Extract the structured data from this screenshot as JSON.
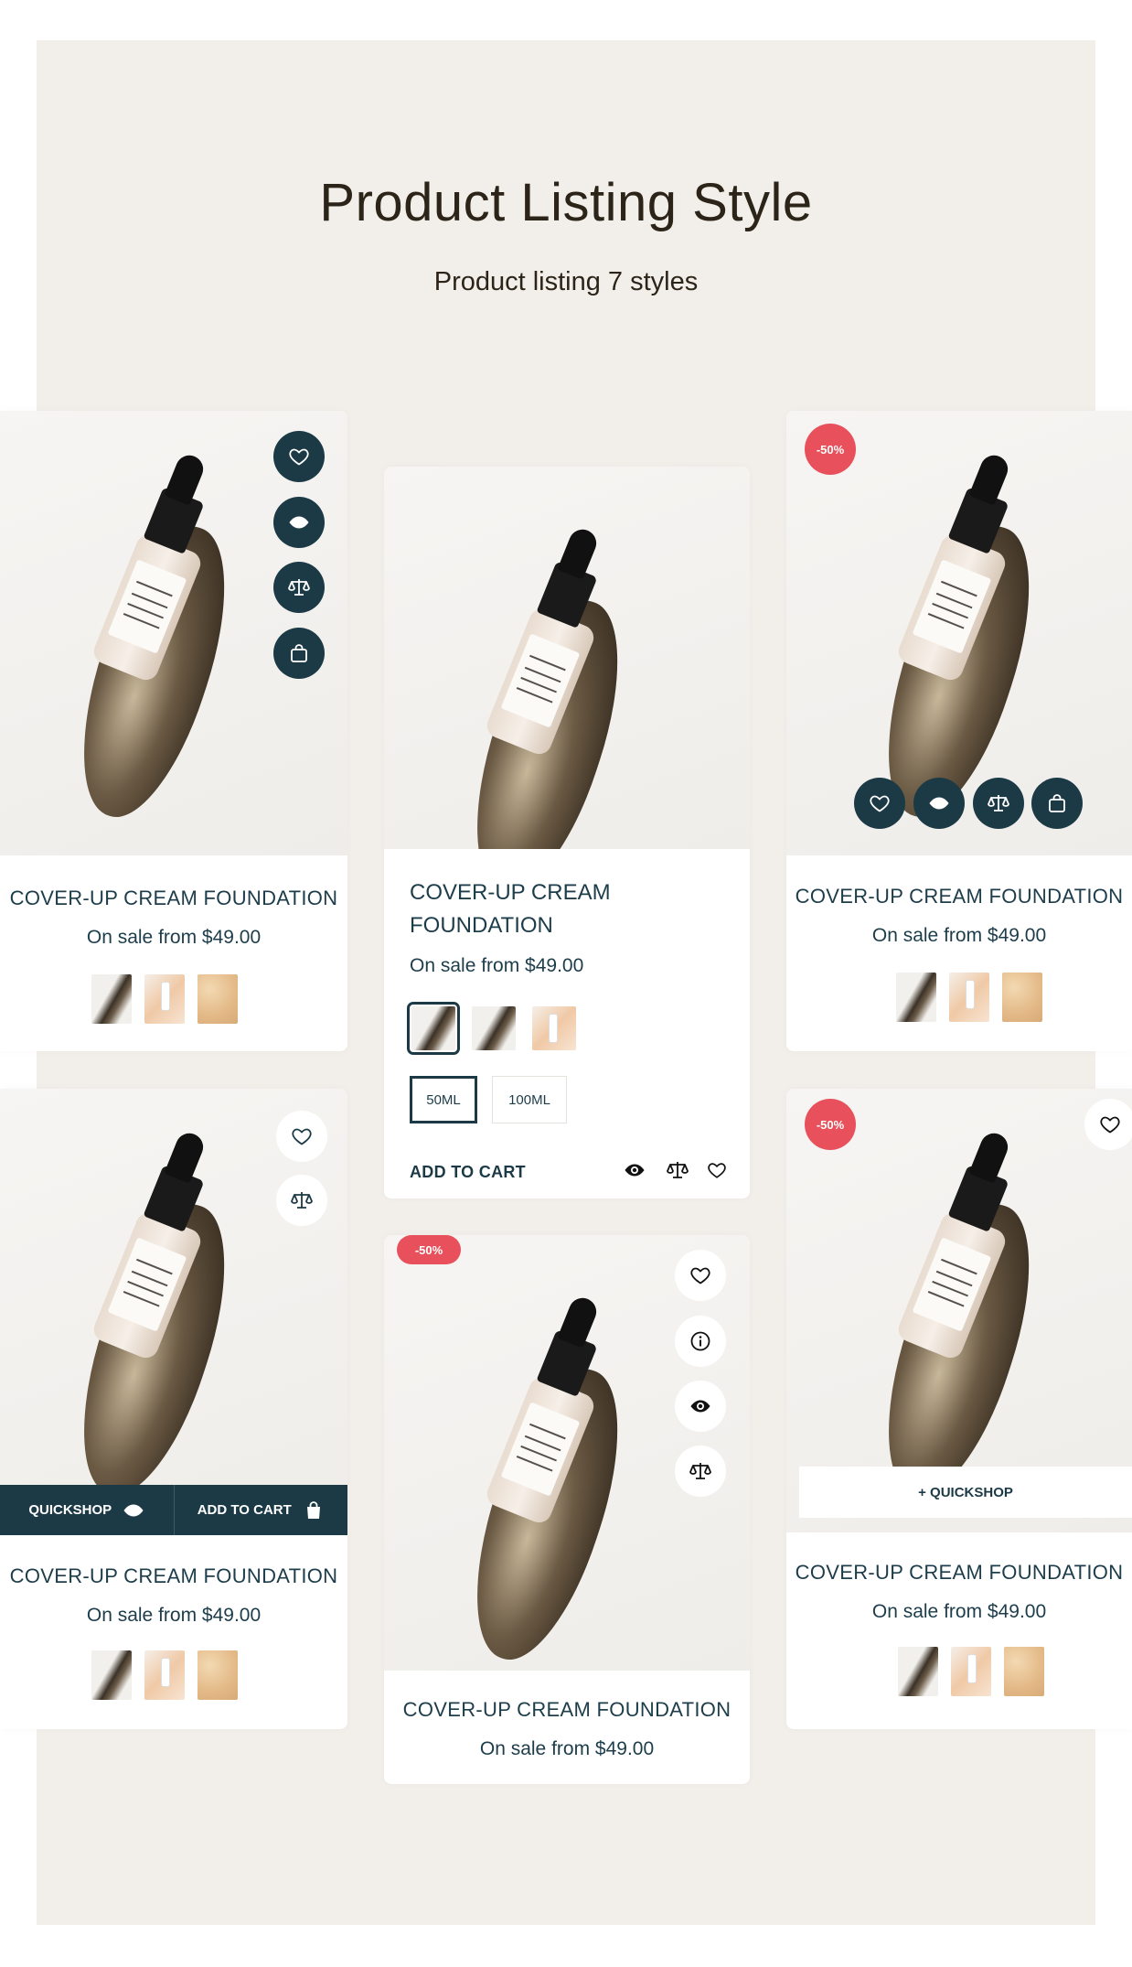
{
  "header": {
    "title": "Product Listing Style",
    "subtitle": "Product listing 7 styles"
  },
  "product": {
    "name": "COVER-UP CREAM FOUNDATION",
    "name_line1": "COVER-UP CREAM",
    "name_line2": "FOUNDATION",
    "price": "On sale from $49.00"
  },
  "badges": {
    "discount": "-50%"
  },
  "actions": {
    "quickshop": "QUICKSHOP",
    "add_to_cart": "ADD TO CART",
    "plus_quickshop": "+ QUICKSHOP"
  },
  "sizes": [
    "50ML",
    "100ML"
  ],
  "icons": {
    "wishlist": "heart-icon",
    "quickview": "eye-icon",
    "compare": "scale-icon",
    "cart": "shopping-bag-icon",
    "info": "info-icon"
  },
  "colors": {
    "accent_dark": "#1c3a46",
    "badge_red": "#e8505b",
    "panel_bg": "#f2efea"
  }
}
